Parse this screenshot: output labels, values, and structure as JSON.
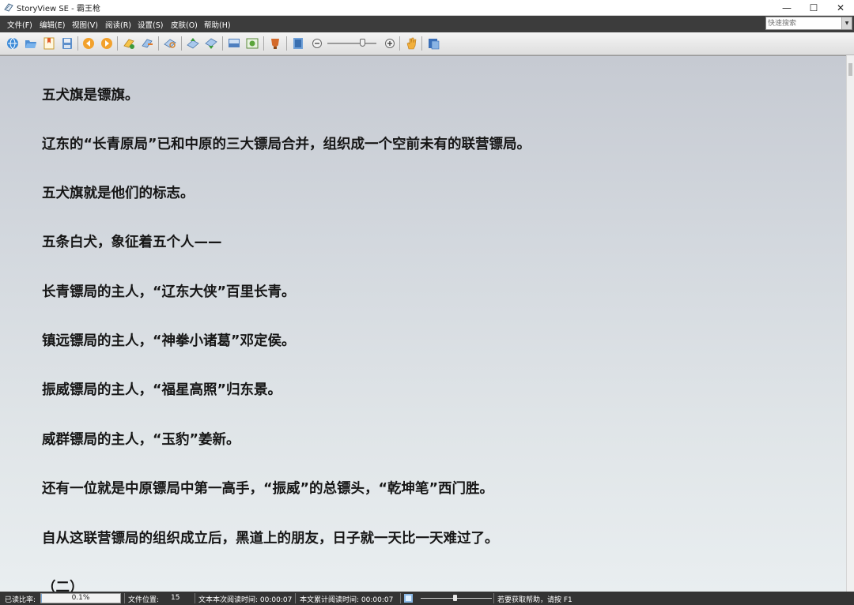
{
  "window": {
    "title": "StoryView SE - 霸王枪",
    "minimize_glyph": "—",
    "maximize_glyph": "☐",
    "close_glyph": "✕"
  },
  "menu": {
    "items": [
      "文件(F)",
      "编辑(E)",
      "视图(V)",
      "阅读(R)",
      "设置(S)",
      "皮肤(O)",
      "帮助(H)"
    ]
  },
  "search": {
    "placeholder": "快速搜索"
  },
  "toolbar": {
    "icons": [
      "open-online-icon",
      "open-file-icon",
      "bookmark-file-icon",
      "save-icon",
      "prev-chapter-icon",
      "next-chapter-icon",
      "add-bookmark-icon",
      "goto-bookmark-icon",
      "find-icon",
      "page-up-icon",
      "page-down-icon",
      "screen-mode-icon",
      "image-icon",
      "color-icon",
      "fullscreen-icon",
      "zoom-out-icon",
      "zoom-in-icon",
      "auto-scroll-hand-icon",
      "about-icon"
    ]
  },
  "content": {
    "paragraphs": [
      "五犬旗是镖旗。",
      "辽东的“长青原局”已和中原的三大镖局合并，组织成一个空前未有的联营镖局。",
      "五犬旗就是他们的标志。",
      "五条白犬，象征着五个人——",
      "长青镖局的主人，“辽东大侠”百里长青。",
      "镇远镖局的主人，“神拳小诸葛”邓定侯。",
      "振威镖局的主人，“福星高照”归东景。",
      "威群镖局的主人，“玉豹”姜新。",
      "还有一位就是中原镖局中第一高手，“振威”的总镖头，“乾坤笔”西门胜。",
      "自从这联营镖局的组织成立后，黑道上的朋友，日子就一天比一天难过了。",
      "（二）"
    ]
  },
  "status": {
    "read_ratio_label": "已读比率:",
    "read_ratio_value": "0.1%",
    "read_ratio_fraction": 0.001,
    "file_position_label": "文件位置:",
    "file_position_value": "15",
    "session_time": "文本本次阅读时间: 00:00:07",
    "total_time": "本文累计阅读时间: 00:00:07",
    "help_hint": "若要获取帮助，请按 F1"
  },
  "colors": {
    "menubar": "#3c3c3c",
    "statusbar": "#343434",
    "text": "#161616"
  }
}
